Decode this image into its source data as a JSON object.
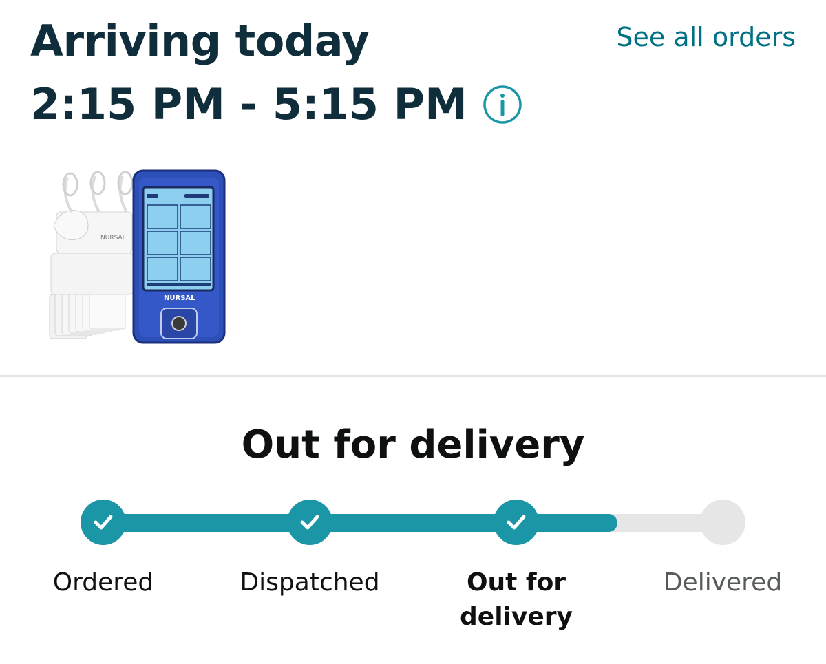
{
  "header": {
    "title": "Arriving today",
    "time_window": "2:15 PM - 5:15 PM",
    "see_all_label": "See all orders",
    "info_icon": "info-icon"
  },
  "product": {
    "brand_text": "NURSAL",
    "image_description_icon": "tens-unit-product-image"
  },
  "tracking": {
    "status_title": "Out for delivery",
    "progress_fraction": 0.83,
    "steps": [
      {
        "label": "Ordered",
        "state": "done"
      },
      {
        "label": "Dispatched",
        "state": "done"
      },
      {
        "label": "Out for delivery",
        "state": "current"
      },
      {
        "label": "Delivered",
        "state": "todo"
      }
    ]
  },
  "colors": {
    "accent": "#1b96a6",
    "link": "#007185",
    "title": "#0f2d3a",
    "inactive": "#e6e6e6"
  }
}
